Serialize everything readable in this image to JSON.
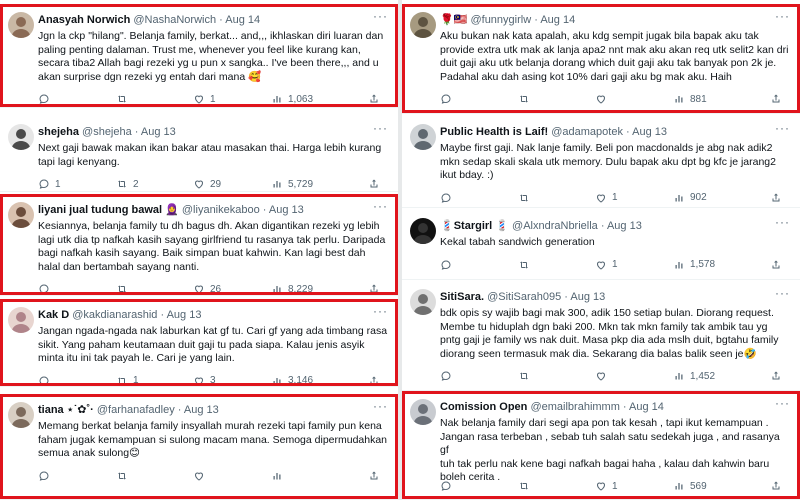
{
  "tweets": [
    {
      "name": "Anasyah Norwich",
      "handle": "@NashaNorwich",
      "date": "Aug 14",
      "lines": [
        "Jgn la ckp \"hilang\". Belanja family, berkat... and,,, ikhlaskan diri luaran dan",
        "paling penting dalaman. Trust me, whenever you feel like kurang kan,",
        "secara tiba2 Allah bagi rezeki yg u pun x sangka.. I've been there,,, and u",
        "akan surprise dgn rezeki yg entah dari mana 🥰"
      ],
      "stats": {
        "replies": "",
        "retweets": "",
        "likes": "1",
        "views": "1,063"
      },
      "avatar": {
        "bg": "#c9b8a5",
        "fg": "#8a6a55"
      }
    },
    {
      "name": "shejeha",
      "handle": "@shejeha",
      "date": "Aug 13",
      "lines": [
        "Next gaji bawak makan ikan bakar atau masakan thai. Harga lebih kurang",
        "tapi lagi kenyang."
      ],
      "stats": {
        "replies": "1",
        "retweets": "2",
        "likes": "29",
        "views": "5,729"
      },
      "avatar": {
        "bg": "#e6e6e6",
        "fg": "#4a4a4a"
      }
    },
    {
      "name": "liyani jual tudung bawal 🧕",
      "handle": "@liyanikekaboo",
      "date": "Aug 13",
      "lines": [
        "Kesiannya, belanja family tu dh bagus dh. Akan digantikan rezeki yg lebih",
        "lagi utk dia tp nafkah kasih sayang girlfriend tu rasanya tak perlu. Daripada",
        "bagi nafkah kasih sayang. Baik simpan buat kahwin. Kan lagi best dah",
        "halal dan bertambah sayang nanti."
      ],
      "stats": {
        "replies": "",
        "retweets": "",
        "likes": "26",
        "views": "8,229"
      },
      "avatar": {
        "bg": "#d9c2b0",
        "fg": "#6b4d3c"
      }
    },
    {
      "name": "Kak D",
      "handle": "@kakdianarashid",
      "date": "Aug 13",
      "lines": [
        "Jangan ngada-ngada nak laburkan kat gf tu. Cari gf yang ada timbang rasa",
        "sikit. Yang paham keutamaan duit gaji tu pada siapa. Kalau jenis asyik",
        "minta itu ini tak payah le. Cari je yang lain."
      ],
      "stats": {
        "replies": "",
        "retweets": "1",
        "likes": "3",
        "views": "3,146"
      },
      "avatar": {
        "bg": "#e8d5d0",
        "fg": "#b0848a"
      }
    },
    {
      "name": "tiana ⋆˙✿˚·",
      "handle": "@farhanafadley",
      "date": "Aug 13",
      "lines": [
        "Memang berkat belanja family insyallah murah rezeki tapi family pun kena",
        "faham jugak kemampuan si sulong macam mana. Semoga dipermudahkan",
        "semua anak sulong😊"
      ],
      "stats": {
        "replies": "",
        "retweets": "",
        "likes": "",
        "views": ""
      },
      "avatar": {
        "bg": "#d8cfc4",
        "fg": "#7c6a5c"
      }
    },
    {
      "name": "🌹🇲🇾",
      "handle": "@funnygirlw",
      "date": "Aug 14",
      "lines": [
        "Aku bukan nak kata apalah, aku kdg sempit jugak bila bapak aku tak",
        "provide extra utk mak ak lanja apa2 nnt mak aku akan req utk selit2 kan dri",
        "duit gaji aku utk belanja dorang which duit gaji aku tak banyak pon 2k je.",
        "Padahal aku dah asing kot 10% dari gaji aku bg mak aku. Haih"
      ],
      "stats": {
        "replies": "",
        "retweets": "",
        "likes": "",
        "views": "881"
      },
      "avatar": {
        "bg": "#a69a80",
        "fg": "#5d5340"
      }
    },
    {
      "name": "Public Health is Laif!",
      "handle": "@adamapotek",
      "date": "Aug 13",
      "lines": [
        "Maybe first gaji. Nak lanje family. Beli pon macdonalds je abg nak adik2",
        "mkn sedap skali skala utk memory. Dulu bapak aku dpt bg kfc je jarang2",
        "ikut bday. :)"
      ],
      "stats": {
        "replies": "",
        "retweets": "",
        "likes": "1",
        "views": "902"
      },
      "avatar": {
        "bg": "#cfd3d6",
        "fg": "#5f6870"
      }
    },
    {
      "name": "💈Stargirl 💈",
      "handle": "@AlxndraNbriella",
      "date": "Aug 13",
      "lines": [
        "Kekal tabah sandwich generation"
      ],
      "stats": {
        "replies": "",
        "retweets": "",
        "likes": "1",
        "views": "1,578"
      },
      "avatar": {
        "bg": "#111111",
        "fg": "#333333"
      }
    },
    {
      "name": "SitiSara.",
      "handle": "@SitiSarah095",
      "date": "Aug 13",
      "lines": [
        "bdk opis sy wajib bagi mak 300, adik 150 setiap bulan. Diorang request.",
        "Membe tu hiduplah dgn baki 200. Mkn tak mkn family tak ambik tau yg",
        "pntg gaji je family ws nak duit. Masa pkp dia ada mslh duit, bgtahu family",
        "diorang seen termasuk mak dia. Sekarang dia balas balik seen je🤣"
      ],
      "stats": {
        "replies": "",
        "retweets": "",
        "likes": "",
        "views": "1,452"
      },
      "avatar": {
        "bg": "#dcdcdc",
        "fg": "#707070"
      }
    },
    {
      "name": "Comission Open",
      "handle": "@emailbrahimmm",
      "date": "Aug 14",
      "lines": [
        "Nak belanja family dari segi apa pon tak kesah  , tapi ikut kemampuan .",
        "Jangan rasa terbeban  , sebab tuh salah satu sedekah juga  , and rasanya gf",
        "tuh tak perlu nak kene bagi nafkah bagai haha  , kalau dah kahwin baru",
        "boleh cerita ."
      ],
      "stats": {
        "replies": "",
        "retweets": "",
        "likes": "1",
        "views": "569"
      },
      "avatar": {
        "bg": "#c8cbd0",
        "fg": "#6b7078"
      }
    }
  ]
}
